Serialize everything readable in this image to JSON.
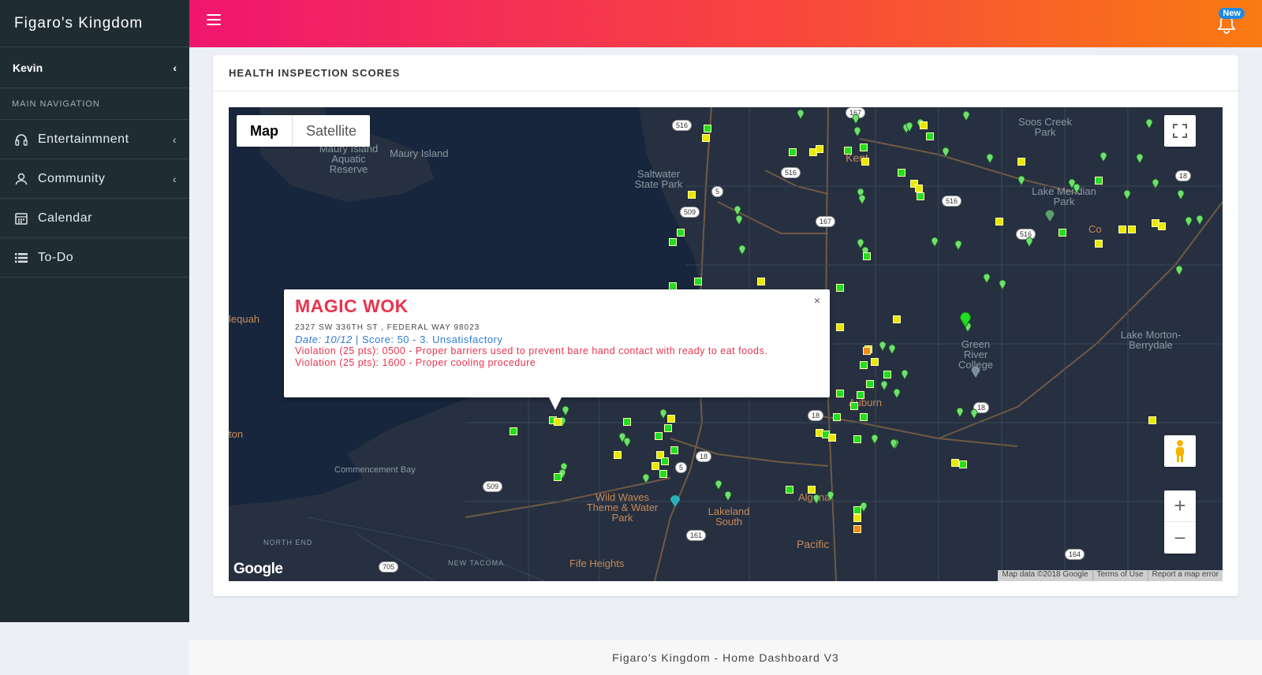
{
  "app": {
    "title": "Figaro's Kingdom"
  },
  "sidebar": {
    "user": "Kevin",
    "section_header": "MAIN NAVIGATION",
    "items": [
      {
        "label": "Entertainmnent",
        "icon": "headphones-icon",
        "has_submenu": true
      },
      {
        "label": "Community",
        "icon": "user-icon",
        "has_submenu": true
      },
      {
        "label": "Calendar",
        "icon": "calendar-icon",
        "has_submenu": false
      },
      {
        "label": "To-Do",
        "icon": "list-icon",
        "has_submenu": false
      }
    ]
  },
  "header": {
    "notification_badge": "New"
  },
  "panel": {
    "title": "HEALTH INSPECTION SCORES"
  },
  "map": {
    "type_buttons": {
      "map": "Map",
      "satellite": "Satellite"
    },
    "labels": {
      "maury_island_aquatic": "Maury Island Aquatic Reserve",
      "maury_island": "Maury Island",
      "saltwater": "Saltwater State Park",
      "kent": "Kent",
      "soos_creek": "Soos Creek Park",
      "lake_meridian": "Lake Meridian Park",
      "green_river": "Green River College",
      "lake_morton": "Lake Morton-Berrydale",
      "auburn": "Auburn",
      "algona": "Algona",
      "pacific": "Pacific",
      "lakeland": "Lakeland South",
      "wild_waves": "Wild Waves Theme & Water Park",
      "commencement": "Commencement Bay",
      "north_end": "NORTH END",
      "new_tacoma": "NEW TACOMA",
      "fife": "Fife Heights",
      "dash_point": "lequah",
      "tacoma": "ton",
      "covington": "Co"
    },
    "shields": [
      "516",
      "167",
      "5",
      "509",
      "516",
      "167",
      "18",
      "18",
      "5",
      "509",
      "161",
      "164",
      "705",
      "18",
      "516",
      "516",
      "18"
    ],
    "attribution": {
      "data": "Map data ©2018 Google",
      "terms": "Terms of Use",
      "report": "Report a map error"
    },
    "google_logo": "Google"
  },
  "info_window": {
    "name": "MAGIC WOK",
    "address": "2327 SW 336TH ST , FEDERAL WAY 98023",
    "date_label": "Date: 10/12",
    "separator": "|",
    "score_label": "Score:",
    "score_value": "50 - 3. Unsatisfactory",
    "violations": [
      "Violation (25 pts): 0500 - Proper barriers used to prevent bare hand contact with ready to eat foods.",
      "Violation (25 pts): 1600 - Proper cooling procedure"
    ],
    "close_glyph": "×"
  },
  "colors": {
    "accent_start": "#f0166f",
    "accent_end": "#f97b12",
    "sidebar": "#1f2d33",
    "marker_green": "#22dd22",
    "marker_yellow": "#e8e800",
    "marker_orange": "#f28a1c",
    "pin_green": "#6ee06e"
  },
  "footer": {
    "text": "Figaro's Kingdom - Home Dashboard V3"
  }
}
